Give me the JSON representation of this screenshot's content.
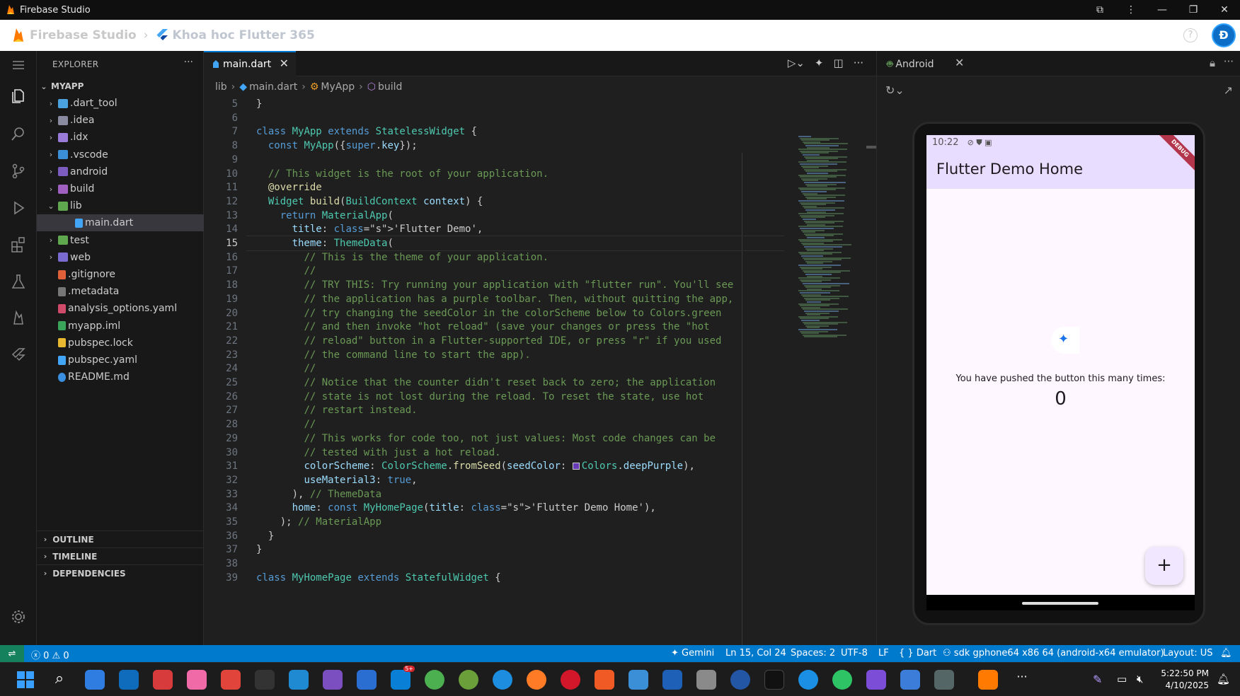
{
  "window": {
    "title": "Firebase Studio"
  },
  "header": {
    "brand": "Firebase Studio",
    "project": "Khoa hoc Flutter 365",
    "help": "?",
    "avatar": "Đ"
  },
  "explorer": {
    "title": "EXPLORER",
    "root": "MYAPP",
    "items": [
      {
        "label": ".dart_tool",
        "type": "folder"
      },
      {
        "label": ".idea",
        "type": "folder"
      },
      {
        "label": ".idx",
        "type": "folder"
      },
      {
        "label": ".vscode",
        "type": "folder"
      },
      {
        "label": "android",
        "type": "folder"
      },
      {
        "label": "build",
        "type": "folder"
      },
      {
        "label": "lib",
        "type": "folder-open"
      },
      {
        "label": "main.dart",
        "type": "dart"
      },
      {
        "label": "test",
        "type": "folder"
      },
      {
        "label": "web",
        "type": "folder"
      },
      {
        "label": ".gitignore",
        "type": "git"
      },
      {
        "label": ".metadata",
        "type": "file"
      },
      {
        "label": "analysis_options.yaml",
        "type": "yaml"
      },
      {
        "label": "myapp.iml",
        "type": "iml"
      },
      {
        "label": "pubspec.lock",
        "type": "lock"
      },
      {
        "label": "pubspec.yaml",
        "type": "dart"
      },
      {
        "label": "README.md",
        "type": "info"
      }
    ],
    "sections": [
      "OUTLINE",
      "TIMELINE",
      "DEPENDENCIES"
    ]
  },
  "editor": {
    "tab": "main.dart",
    "breadcrumb": [
      "lib",
      "main.dart",
      "MyApp",
      "build"
    ],
    "active_line": 15,
    "lines": [
      {
        "n": 5,
        "t": "}"
      },
      {
        "n": 6,
        "t": ""
      },
      {
        "n": 7,
        "t": "class MyApp extends StatelessWidget {"
      },
      {
        "n": 8,
        "t": "  const MyApp({super.key});"
      },
      {
        "n": 9,
        "t": ""
      },
      {
        "n": 10,
        "t": "  // This widget is the root of your application."
      },
      {
        "n": 11,
        "t": "  @override"
      },
      {
        "n": 12,
        "t": "  Widget build(BuildContext context) {"
      },
      {
        "n": 13,
        "t": "    return MaterialApp("
      },
      {
        "n": 14,
        "t": "      title: 'Flutter Demo',"
      },
      {
        "n": 15,
        "t": "      theme: ThemeData("
      },
      {
        "n": 16,
        "t": "        // This is the theme of your application."
      },
      {
        "n": 17,
        "t": "        //"
      },
      {
        "n": 18,
        "t": "        // TRY THIS: Try running your application with \"flutter run\". You'll see"
      },
      {
        "n": 19,
        "t": "        // the application has a purple toolbar. Then, without quitting the app,"
      },
      {
        "n": 20,
        "t": "        // try changing the seedColor in the colorScheme below to Colors.green"
      },
      {
        "n": 21,
        "t": "        // and then invoke \"hot reload\" (save your changes or press the \"hot"
      },
      {
        "n": 22,
        "t": "        // reload\" button in a Flutter-supported IDE, or press \"r\" if you used"
      },
      {
        "n": 23,
        "t": "        // the command line to start the app)."
      },
      {
        "n": 24,
        "t": "        //"
      },
      {
        "n": 25,
        "t": "        // Notice that the counter didn't reset back to zero; the application"
      },
      {
        "n": 26,
        "t": "        // state is not lost during the reload. To reset the state, use hot"
      },
      {
        "n": 27,
        "t": "        // restart instead."
      },
      {
        "n": 28,
        "t": "        //"
      },
      {
        "n": 29,
        "t": "        // This works for code too, not just values: Most code changes can be"
      },
      {
        "n": 30,
        "t": "        // tested with just a hot reload."
      },
      {
        "n": 31,
        "t": "        colorScheme: ColorScheme.fromSeed(seedColor: Colors.deepPurple),"
      },
      {
        "n": 32,
        "t": "        useMaterial3: true,"
      },
      {
        "n": 33,
        "t": "      ), // ThemeData"
      },
      {
        "n": 34,
        "t": "      home: const MyHomePage(title: 'Flutter Demo Home'),"
      },
      {
        "n": 35,
        "t": "    ); // MaterialApp"
      },
      {
        "n": 36,
        "t": "  }"
      },
      {
        "n": 37,
        "t": "}"
      },
      {
        "n": 38,
        "t": ""
      },
      {
        "n": 39,
        "t": "class MyHomePage extends StatefulWidget {"
      }
    ]
  },
  "android_panel": {
    "tab": "Android",
    "phone": {
      "time": "10:22",
      "app_title": "Flutter Demo Home",
      "debug_banner": "DEBUG",
      "counter_label": "You have pushed the button this many times:",
      "counter_value": "0",
      "fab_label": "+"
    }
  },
  "statusbar": {
    "problems": "0",
    "warnings": "0",
    "gemini": "Gemini",
    "position": "Ln 15, Col 24",
    "spaces": "Spaces: 2",
    "encoding": "UTF-8",
    "eol": "LF",
    "language": "Dart",
    "device": "sdk gphone64 x86 64 (android-x64 emulator)",
    "layout": "Layout: US"
  },
  "taskbar": {
    "time": "5:22:50 PM",
    "date": "4/10/2025",
    "badge": "5+"
  },
  "colors": {
    "accent": "#007acc",
    "purple": "#673ab7",
    "appbar": "#e9ddff"
  }
}
